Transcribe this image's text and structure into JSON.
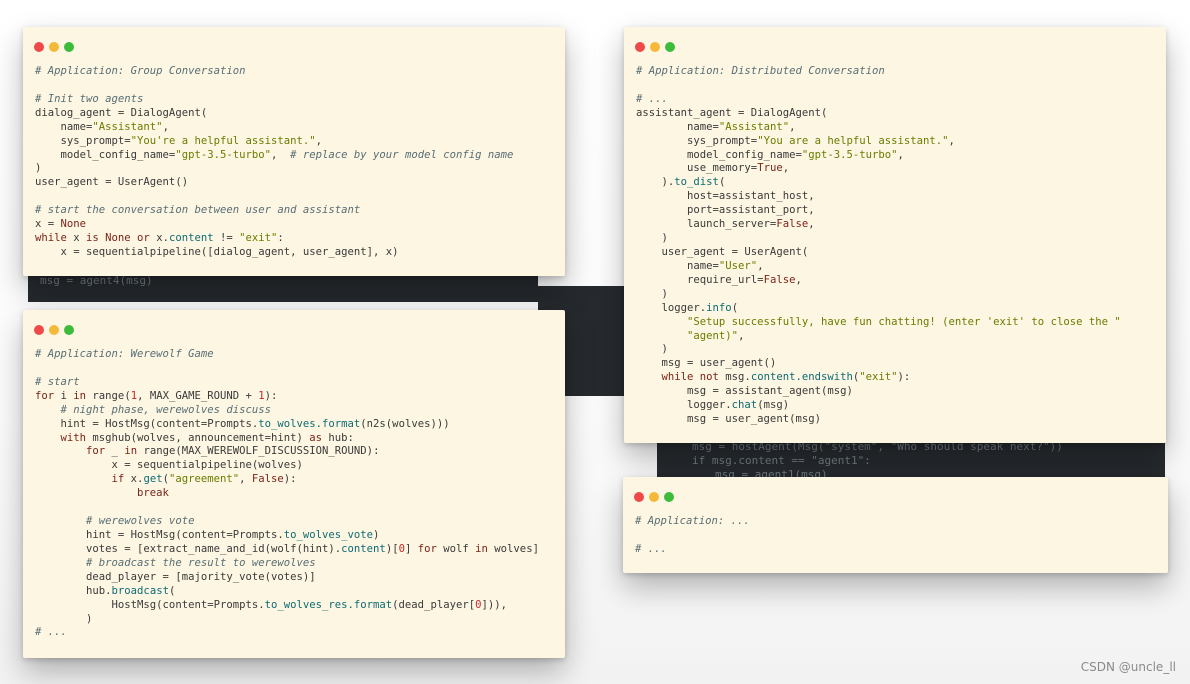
{
  "colors": {
    "window_bg": "#fdf6e3",
    "comment": "#586e75",
    "string": "#6a7d00",
    "keyword": "#7a2518",
    "number": "#c62828",
    "method": "#0e6b73",
    "dot_red": "#f0494a",
    "dot_yellow": "#f5b93a",
    "dot_green": "#3dbb3a"
  },
  "background": {
    "ghost_1": "msg = agent4(msg)",
    "ghost_2": "msg = hostAgent(Msg(\"system\", \"Who should speak next?\"))",
    "ghost_3": "if msg.content == \"agent1\":",
    "ghost_4": "msg = agent1(msg)"
  },
  "windows": {
    "group": {
      "l1": "# Application: Group Conversation",
      "l2": "# Init two agents",
      "l3a": "dialog_agent = DialogAgent(",
      "l4a": "    name=",
      "l4s": "\"Assistant\"",
      "l4b": ",",
      "l5a": "    sys_prompt=",
      "l5s": "\"You're a helpful assistant.\"",
      "l5b": ",",
      "l6a": "    model_config_name=",
      "l6s": "\"gpt-3.5-turbo\"",
      "l6b": ",  ",
      "l6c": "# replace by your model config name",
      "l7": ")",
      "l8": "user_agent = UserAgent()",
      "l9": "# start the conversation between user and assistant",
      "l10a": "x = ",
      "l10k": "None",
      "l11k1": "while",
      "l11a": " x ",
      "l11k2": "is None or",
      "l11b": " x.",
      "l11c": "content",
      "l11d": " != ",
      "l11s": "\"exit\"",
      "l11e": ":",
      "l12": "    x = sequentialpipeline([dialog_agent, user_agent], x)"
    },
    "werewolf": {
      "l1": "# Application: Werewolf Game",
      "l2": "# start",
      "l3k1": "for",
      "l3a": " i ",
      "l3k2": "in",
      "l3b": " range(",
      "l3n1": "1",
      "l3c": ", MAX_GAME_ROUND + ",
      "l3n2": "1",
      "l3d": "):",
      "l4": "    # night phase, werewolves discuss",
      "l5a": "    hint = HostMsg(content=Prompts.",
      "l5f": "to_wolves.format",
      "l5b": "(n2s(wolves)))",
      "l6k1": "    with",
      "l6a": " msghub(wolves, announcement=hint) ",
      "l6k2": "as",
      "l6b": " hub:",
      "l7k1": "        for",
      "l7a": " _ ",
      "l7k2": "in",
      "l7b": " range(MAX_WEREWOLF_DISCUSSION_ROUND):",
      "l8": "            x = sequentialpipeline(wolves)",
      "l9k": "            if",
      "l9a": " x.",
      "l9f": "get",
      "l9b": "(",
      "l9s": "\"agreement\"",
      "l9c": ", ",
      "l9k2": "False",
      "l9d": "):",
      "l10": "                break",
      "l11": "        # werewolves vote",
      "l12a": "        hint = HostMsg(content=Prompts.",
      "l12f": "to_wolves_vote",
      "l12b": ")",
      "l13a": "        votes = [extract_name_and_id(wolf(hint).",
      "l13f": "content",
      "l13b": ")[",
      "l13n": "0",
      "l13c": "] ",
      "l13k1": "for",
      "l13d": " wolf ",
      "l13k2": "in",
      "l13e": " wolves]",
      "l14": "        # broadcast the result to werewolves",
      "l15": "        dead_player = [majority_vote(votes)]",
      "l16a": "        hub.",
      "l16f": "broadcast",
      "l16b": "(",
      "l17a": "            HostMsg(content=Prompts.",
      "l17f": "to_wolves_res.format",
      "l17b": "(dead_player[",
      "l17n": "0",
      "l17c": "])),",
      "l18": "        )",
      "l19": "# ..."
    },
    "distributed": {
      "l1": "# Application: Distributed Conversation",
      "l2": "# ...",
      "l3": "assistant_agent = DialogAgent(",
      "l4a": "        name=",
      "l4s": "\"Assistant\"",
      "l4b": ",",
      "l5a": "        sys_prompt=",
      "l5s": "\"You are a helpful assistant.\"",
      "l5b": ",",
      "l6a": "        model_config_name=",
      "l6s": "\"gpt-3.5-turbo\"",
      "l6b": ",",
      "l7a": "        use_memory=",
      "l7k": "True",
      "l7b": ",",
      "l8a": "    ).",
      "l8f": "to_dist",
      "l8b": "(",
      "l9": "        host=assistant_host,",
      "l10": "        port=assistant_port,",
      "l11a": "        launch_server=",
      "l11k": "False",
      "l11b": ",",
      "l12": "    )",
      "l13": "    user_agent = UserAgent(",
      "l14a": "        name=",
      "l14s": "\"User\"",
      "l14b": ",",
      "l15a": "        require_url=",
      "l15k": "False",
      "l15b": ",",
      "l16": "    )",
      "l17a": "    logger.",
      "l17f": "info",
      "l17b": "(",
      "l18s": "        \"Setup successfully, have fun chatting! (enter 'exit' to close the \"",
      "l19s": "        \"agent)\"",
      "l19b": ",",
      "l20": "    )",
      "l21": "    msg = user_agent()",
      "l22k": "    while not",
      "l22a": " msg.",
      "l22f": "content.endswith",
      "l22b": "(",
      "l22s": "\"exit\"",
      "l22c": "):",
      "l23": "        msg = assistant_agent(msg)",
      "l24a": "        logger.",
      "l24f": "chat",
      "l24b": "(msg)",
      "l25": "        msg = user_agent(msg)"
    },
    "app": {
      "l1": "# Application: ...",
      "l2": "# ..."
    }
  },
  "watermark": "CSDN @uncle_ll"
}
